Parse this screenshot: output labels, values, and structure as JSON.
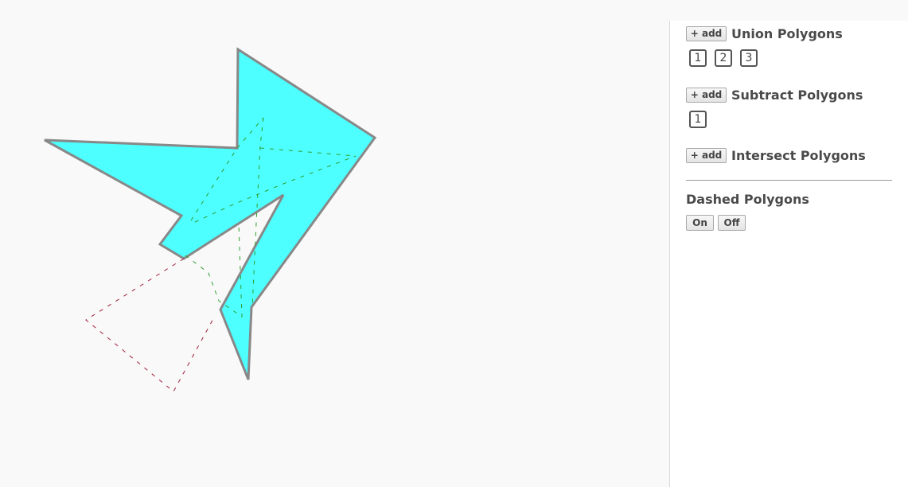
{
  "panel": {
    "union": {
      "add_label": "+ add",
      "title": "Union Polygons",
      "chips": [
        "1",
        "2",
        "3"
      ]
    },
    "subtract": {
      "add_label": "+ add",
      "title": "Subtract Polygons",
      "chips": [
        "1"
      ]
    },
    "intersect": {
      "add_label": "+ add",
      "title": "Intersect Polygons",
      "chips": []
    },
    "dashed": {
      "title": "Dashed Polygons",
      "on_label": "On",
      "off_label": "Off"
    }
  },
  "colors": {
    "polygon_fill": "#4dffff",
    "polygon_stroke": "#888888",
    "union_dash": "#2e9e2e",
    "subtract_dash": "#a0203a",
    "canvas_bg": "#f9f9f9"
  }
}
